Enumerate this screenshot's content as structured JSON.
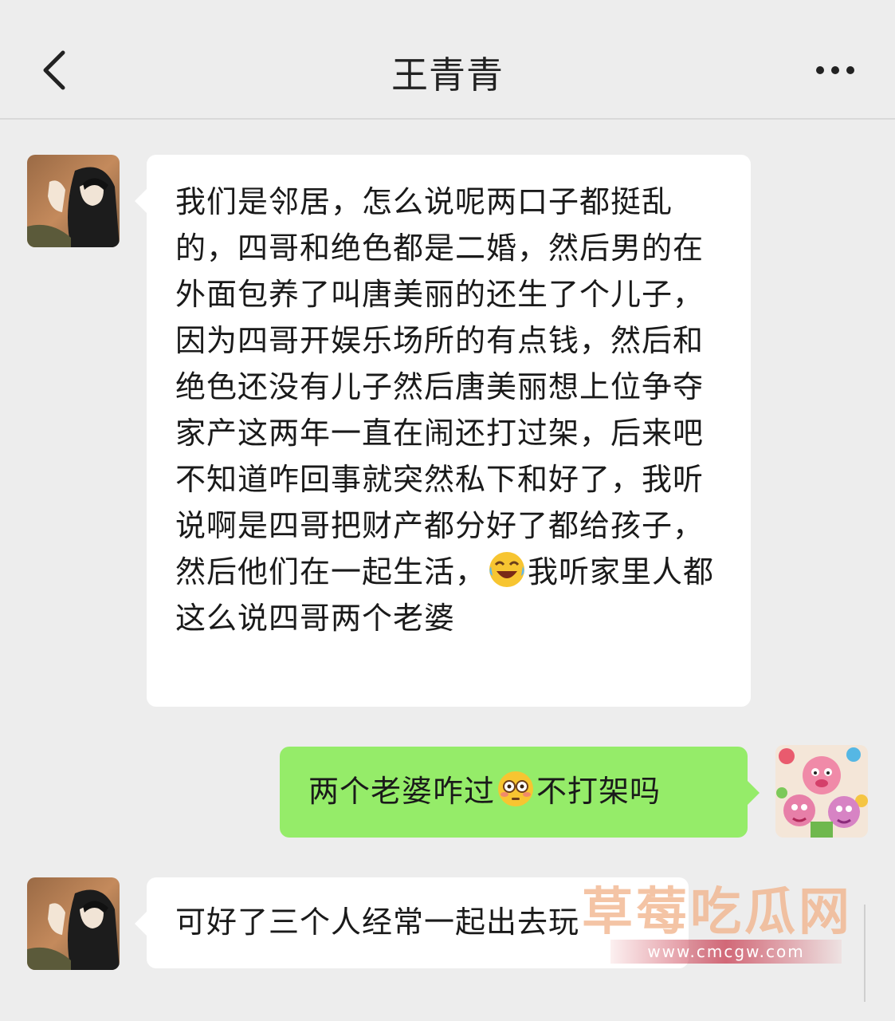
{
  "header": {
    "title": "王青青",
    "back_icon": "chevron-left-icon",
    "more_icon": "ellipsis-icon"
  },
  "messages": [
    {
      "side": "left",
      "avatar": "contact-avatar",
      "text_before": "我们是邻居，怎么说呢两口子都挺乱的，四哥和绝色都是二婚，然后男的在外面包养了叫唐美丽的还生了个儿子，因为四哥开娱乐场所的有点钱，然后和绝色还没有儿子然后唐美丽想上位争夺家产这两年一直在闹还打过架，后来吧不知道咋回事就突然私下和好了，我听说啊是四哥把财产都分好了都给孩子，然后他们在一起生活，",
      "emoji": "laughing-crying-emoji",
      "text_after": "我听家里人都这么说四哥两个老婆"
    },
    {
      "side": "right",
      "avatar": "self-avatar",
      "text_before": "两个老婆咋过",
      "emoji": "flushed-emoji",
      "text_after": "不打架吗"
    },
    {
      "side": "left",
      "avatar": "contact-avatar",
      "text": "可好了三个人经常一起出去玩"
    }
  ],
  "watermark": {
    "title": "草莓吃瓜网",
    "url": "www.cmcgw.com"
  },
  "colors": {
    "background": "#ededed",
    "received_bubble": "#ffffff",
    "sent_bubble": "#95ec69"
  }
}
